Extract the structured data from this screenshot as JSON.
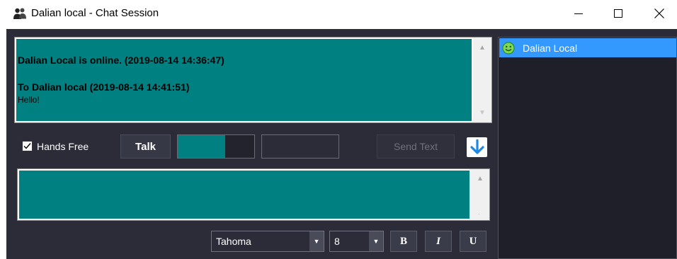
{
  "window": {
    "title": "Dalian local - Chat Session",
    "icons": [
      "users-icon",
      "minimize-icon",
      "maximize-icon",
      "close-icon"
    ]
  },
  "chat_log": {
    "messages": [
      "Dalian Local is online. (2019-08-14 14:36:47)",
      "To Dalian local (2019-08-14 14:41:51)",
      "Hello!"
    ]
  },
  "controls": {
    "hands_free_label": "Hands Free",
    "hands_free_checked": true,
    "talk_label": "Talk",
    "audio_level_fraction": 0.62,
    "send_text_label": "Send Text",
    "send_text_enabled": false
  },
  "message_input": {
    "value": ""
  },
  "format_bar": {
    "font": "Tahoma",
    "size": "8",
    "bold_label": "B",
    "italic_label": "I",
    "underline_label": "U"
  },
  "participants": [
    {
      "name": "Dalian Local",
      "status_icon": "smiley-online-icon",
      "selected": true
    }
  ],
  "colors": {
    "accent_teal": "#008080",
    "selection_blue": "#3399ff",
    "panel_dark": "#2b2c38"
  }
}
